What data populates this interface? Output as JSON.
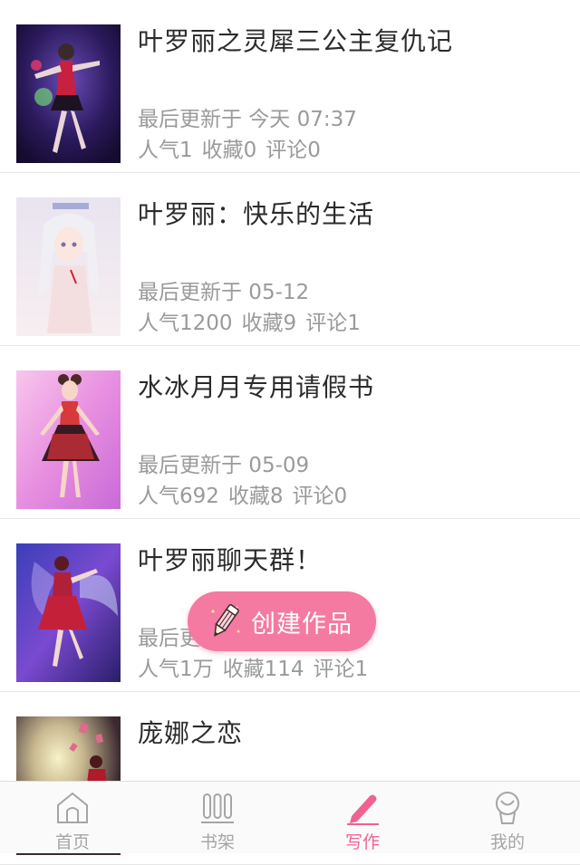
{
  "works": [
    {
      "title": "叶罗丽之灵犀三公主复仇记",
      "updated": "最后更新于 今天 07:37",
      "popularity": "人气1",
      "favorites": "收藏0",
      "comments": "评论0",
      "cover": "dark-purple-dancer"
    },
    {
      "title": "叶罗丽：快乐的生活",
      "updated": "最后更新于 05-12",
      "popularity": "人气1200",
      "favorites": "收藏9",
      "comments": "评论1",
      "cover": "white-hair-girl"
    },
    {
      "title": "水冰月月专用请假书",
      "updated": "最后更新于 05-09",
      "popularity": "人气692",
      "favorites": "收藏8",
      "comments": "评论0",
      "cover": "pink-red-dress-girl"
    },
    {
      "title": "叶罗丽聊天群！",
      "updated": "最后更新于 ...",
      "popularity": "人气1万",
      "favorites": "收藏114",
      "comments": "评论1",
      "cover": "purple-winged-girl"
    },
    {
      "title": "庞娜之恋",
      "updated": "",
      "popularity": "",
      "favorites": "",
      "comments": "",
      "cover": "moon-girl"
    }
  ],
  "fab": {
    "label": "创建作品",
    "icon": "pencil-icon",
    "color": "#f47aa2"
  },
  "tabbar": {
    "tabs": [
      {
        "label": "首页",
        "icon": "home-icon",
        "active": false
      },
      {
        "label": "书架",
        "icon": "bookshelf-icon",
        "active": false
      },
      {
        "label": "写作",
        "icon": "pen-icon",
        "active": true
      },
      {
        "label": "我的",
        "icon": "profile-icon",
        "active": false
      }
    ],
    "active_color": "#f06292",
    "inactive_color": "#a5a5a5"
  }
}
